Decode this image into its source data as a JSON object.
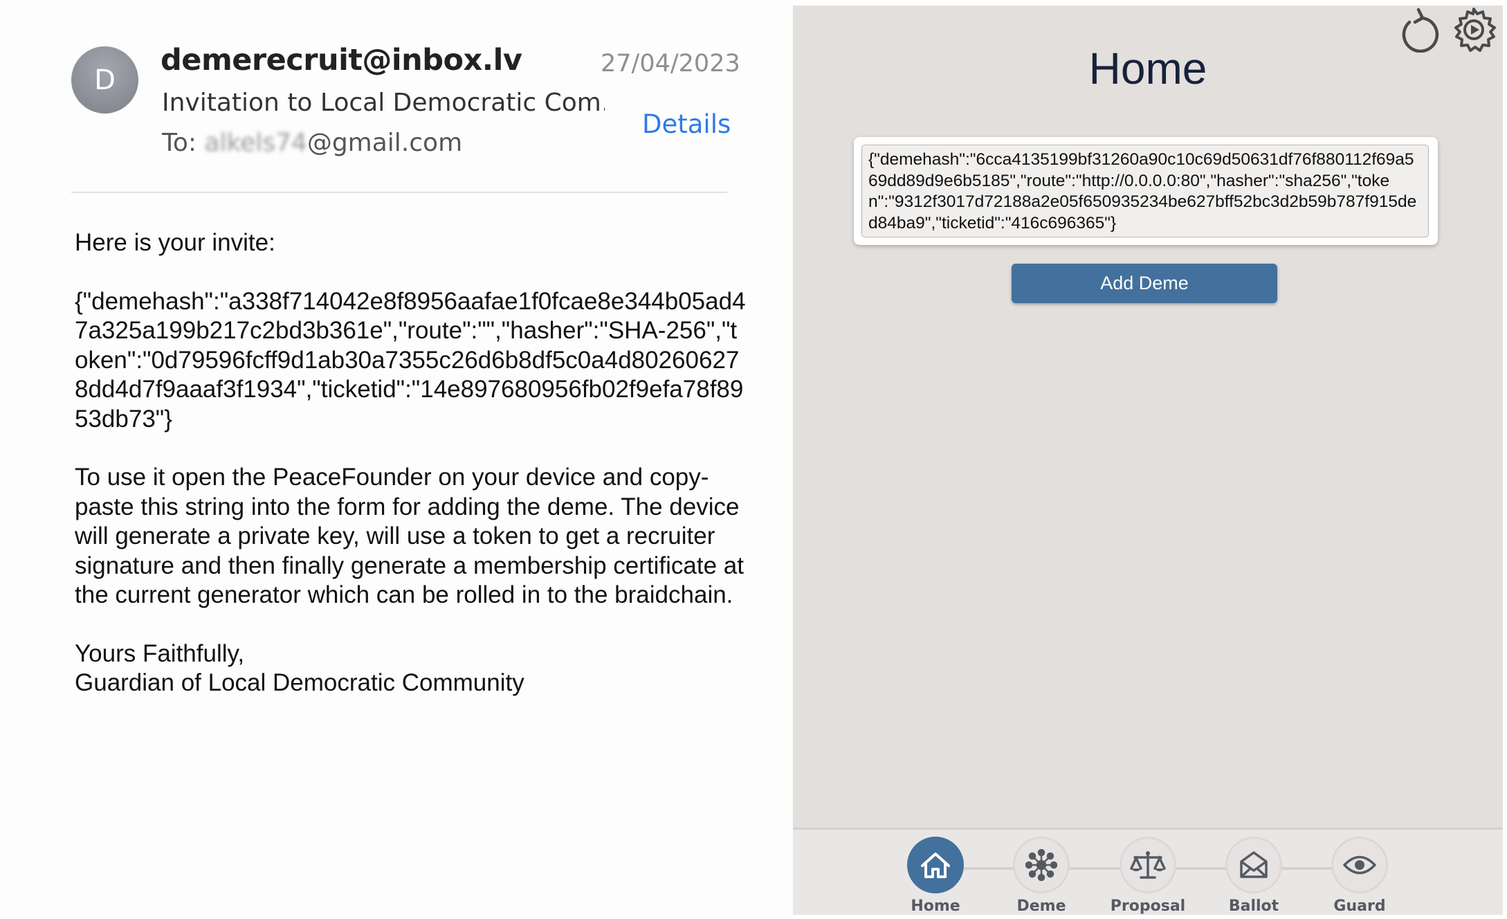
{
  "email": {
    "avatar_initial": "D",
    "sender": "demerecruit@inbox.lv",
    "date": "27/04/2023",
    "subject": "Invitation to Local Democratic Com…",
    "to_prefix": "To: ",
    "to_redacted": "alkels74",
    "to_domain": "@gmail.com",
    "details_label": "Details",
    "body": {
      "greeting": "Here is your invite:",
      "invite_json": "{\"demehash\":\"a338f714042e8f8956aafae1f0fcae8e344b05ad47a325a199b217c2bd3b361e\",\"route\":\"\",\"hasher\":\"SHA-256\",\"token\":\"0d79596fcff9d1ab30a7355c26d6b8df5c0a4d802606278dd4d7f9aaaf3f1934\",\"ticketid\":\"14e897680956fb02f9efa78f8953db73\"}",
      "instructions": "To use it open the PeaceFounder on your device and copy-paste this string into the form for adding the deme. The device will generate a private key, will use a token to get a recruiter signature and then finally generate a membership certificate at the current generator which can be rolled in to the braidchain.",
      "signoff": "Yours Faithfully,",
      "signature": "Guardian of Local Democratic Community"
    }
  },
  "app": {
    "title": "Home",
    "top_icons": [
      "refresh-icon",
      "settings-gear-icon"
    ],
    "input_value": "{\"demehash\":\"6cca4135199bf31260a90c10c69d50631df76f880112f69a569dd89d9e6b5185\",\"route\":\"http://0.0.0.0:80\",\"hasher\":\"sha256\",\"token\":\"9312f3017d72188a2e05f650935234be627bff52bc3d2b59b787f915ded84ba9\",\"ticketid\":\"416c696365\"}",
    "add_button_label": "Add Deme",
    "nav": [
      {
        "label": "Home",
        "icon": "home-icon",
        "active": true
      },
      {
        "label": "Deme",
        "icon": "network-icon",
        "active": false
      },
      {
        "label": "Proposal",
        "icon": "scales-icon",
        "active": false
      },
      {
        "label": "Ballot",
        "icon": "envelope-icon",
        "active": false
      },
      {
        "label": "Guard",
        "icon": "eye-icon",
        "active": false
      }
    ],
    "colors": {
      "accent": "#43709d",
      "panel_bg": "#e2dfdd",
      "link": "#2f7ae5"
    }
  }
}
